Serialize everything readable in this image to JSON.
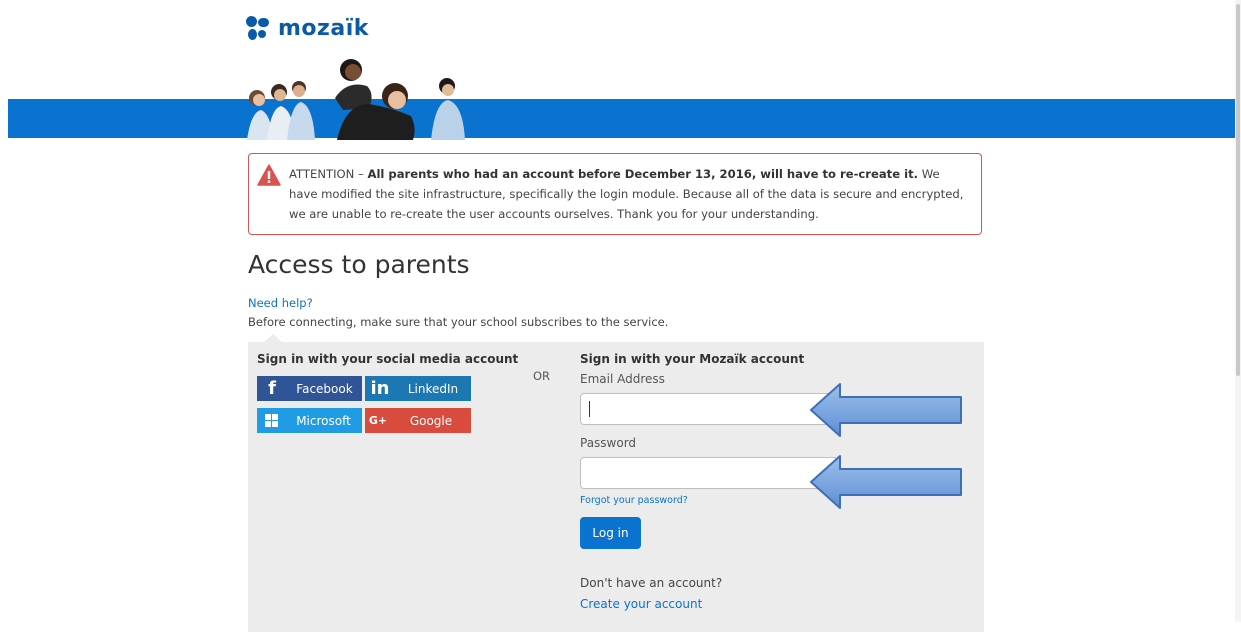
{
  "brand": {
    "name": "mozaïk",
    "color": "#0a5aa8",
    "banner_color": "#0a73cf"
  },
  "alert": {
    "prefix": "ATTENTION – ",
    "bold": "All parents who had an account before December 13, 2016, will have to re-create it.",
    "body": " We have modified the site infrastructure, specifically the login module. Because all of the data is secure and encrypted, we are unable to re-create the user accounts ourselves. Thank you for your understanding.",
    "icon": "warning-icon"
  },
  "page": {
    "title": "Access to parents",
    "help_link": "Need help?",
    "subnote": "Before connecting, make sure that your school subscribes to the service."
  },
  "social": {
    "heading": "Sign in with your social media account",
    "or": "OR",
    "buttons": {
      "facebook": {
        "label": "Facebook",
        "icon": "facebook-icon",
        "color": "#2f5597"
      },
      "linkedin": {
        "label": "LinkedIn",
        "icon": "linkedin-icon",
        "color": "#1b78b3"
      },
      "microsoft": {
        "label": "Microsoft",
        "icon": "windows-icon",
        "color": "#1f9ce3"
      },
      "google": {
        "label": "Google",
        "icon": "google-plus-icon",
        "color": "#d94b3c"
      }
    }
  },
  "login": {
    "heading": "Sign in with your Mozaïk account",
    "email_label": "Email Address",
    "email_value": "",
    "password_label": "Password",
    "password_value": "",
    "forgot": "Forgot your password?",
    "submit": "Log in",
    "no_account": "Don't have an account?",
    "create": "Create your account"
  }
}
